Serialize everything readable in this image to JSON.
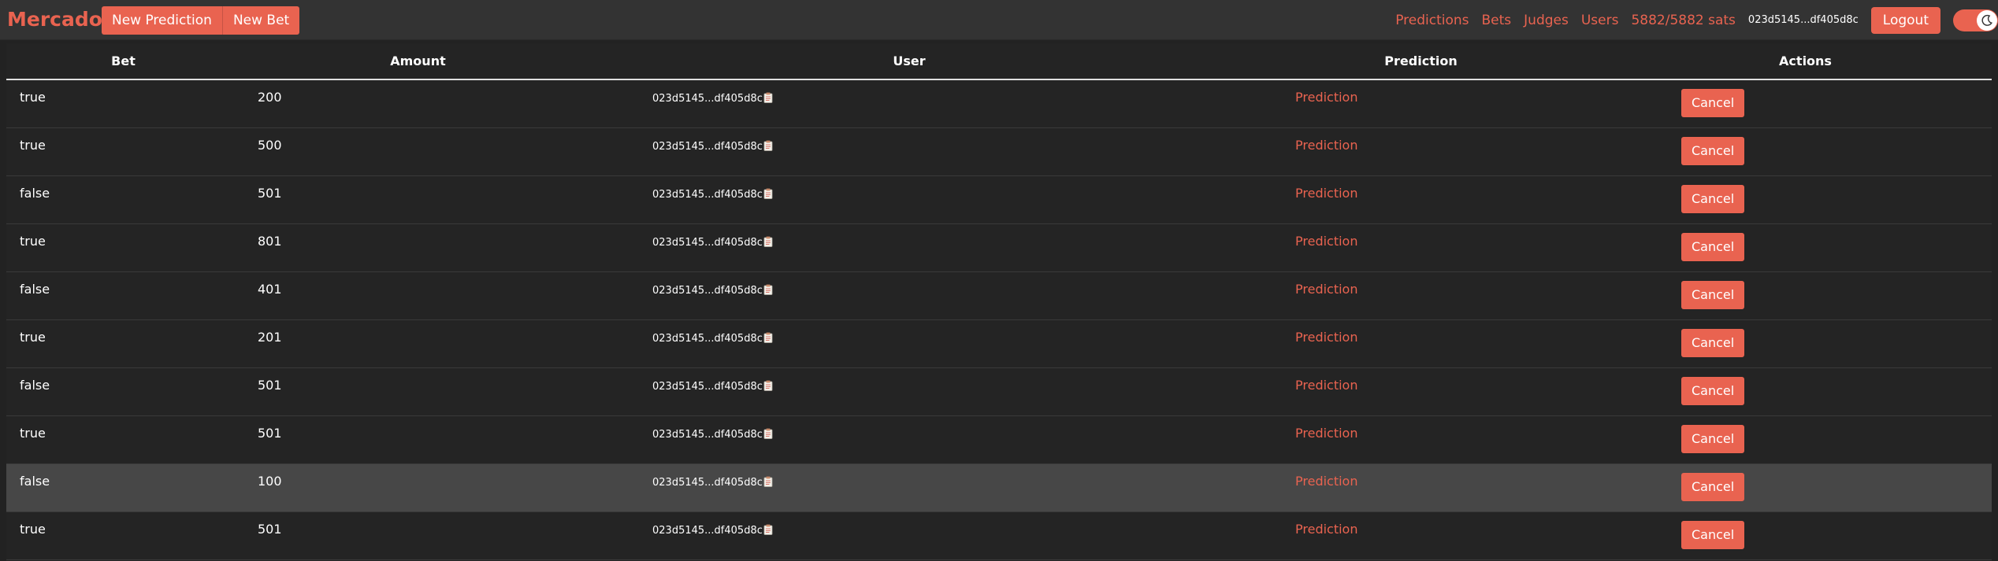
{
  "brand": "Mercado",
  "actions": {
    "new_prediction": "New Prediction",
    "new_bet": "New Bet"
  },
  "nav": {
    "links": [
      "Predictions",
      "Bets",
      "Judges",
      "Users"
    ],
    "sats": "5882/5882 sats",
    "pubkey": "023d5145...df405d8c",
    "logout": "Logout",
    "theme_toggle_icon": "moon-icon"
  },
  "colors": {
    "accent": "#e96350",
    "background": "#222222",
    "navbar": "#333333",
    "highlight_row": "#474747"
  },
  "table": {
    "headers": [
      "Bet",
      "Amount",
      "User",
      "Prediction",
      "Actions"
    ],
    "rows": [
      {
        "bet": "true",
        "amount": "200",
        "user": "023d5145...df405d8c",
        "prediction": "Prediction",
        "action": "Cancel"
      },
      {
        "bet": "true",
        "amount": "500",
        "user": "023d5145...df405d8c",
        "prediction": "Prediction",
        "action": "Cancel"
      },
      {
        "bet": "false",
        "amount": "501",
        "user": "023d5145...df405d8c",
        "prediction": "Prediction",
        "action": "Cancel"
      },
      {
        "bet": "true",
        "amount": "801",
        "user": "023d5145...df405d8c",
        "prediction": "Prediction",
        "action": "Cancel"
      },
      {
        "bet": "false",
        "amount": "401",
        "user": "023d5145...df405d8c",
        "prediction": "Prediction",
        "action": "Cancel"
      },
      {
        "bet": "true",
        "amount": "201",
        "user": "023d5145...df405d8c",
        "prediction": "Prediction",
        "action": "Cancel"
      },
      {
        "bet": "false",
        "amount": "501",
        "user": "023d5145...df405d8c",
        "prediction": "Prediction",
        "action": "Cancel"
      },
      {
        "bet": "true",
        "amount": "501",
        "user": "023d5145...df405d8c",
        "prediction": "Prediction",
        "action": "Cancel"
      },
      {
        "bet": "false",
        "amount": "100",
        "user": "023d5145...df405d8c",
        "prediction": "Prediction",
        "action": "Cancel"
      },
      {
        "bet": "true",
        "amount": "501",
        "user": "023d5145...df405d8c",
        "prediction": "Prediction",
        "action": "Cancel"
      }
    ]
  }
}
